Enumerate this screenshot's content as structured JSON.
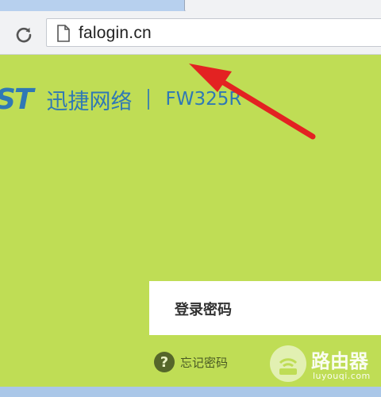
{
  "browser": {
    "url": "falogin.cn"
  },
  "header": {
    "brand_logo": "ST",
    "brand_name": "迅捷网络",
    "separator": "|",
    "model": "FW325R"
  },
  "login": {
    "password_label": "登录密码",
    "forgot_label": "忘记密码",
    "help_glyph": "?"
  },
  "watermark": {
    "title": "路由器",
    "subtitle": "luyouqi.com"
  },
  "colors": {
    "page_background": "#bfdd55",
    "brand_blue": "#2f78b5",
    "annotation_arrow": "#e32222"
  },
  "icons": {
    "reload": "reload-icon",
    "page": "page-icon",
    "help": "help-icon",
    "watermark": "wifi-router-icon"
  }
}
